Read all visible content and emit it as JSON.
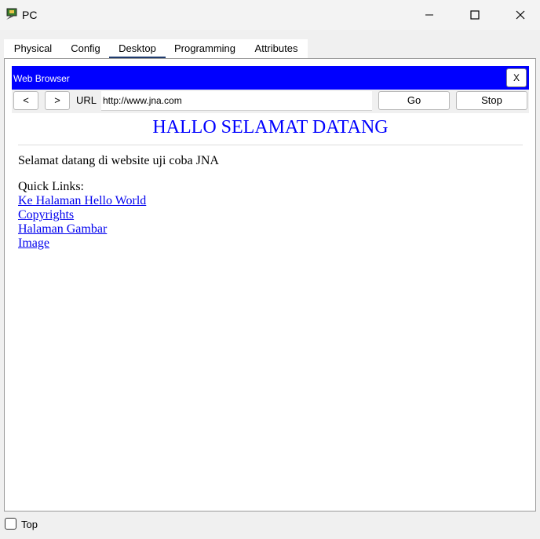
{
  "window": {
    "title": "PC"
  },
  "tabs": [
    {
      "label": "Physical"
    },
    {
      "label": "Config"
    },
    {
      "label": "Desktop"
    },
    {
      "label": "Programming"
    },
    {
      "label": "Attributes"
    }
  ],
  "active_tab": "Desktop",
  "browser": {
    "title": "Web Browser",
    "close_label": "X",
    "back_label": "<",
    "forward_label": ">",
    "url_label": "URL",
    "url_value": "http://www.jna.com",
    "go_label": "Go",
    "stop_label": "Stop"
  },
  "page": {
    "heading": "HALLO SELAMAT DATANG",
    "intro": "Selamat datang di website uji coba JNA",
    "quick_links_label": "Quick Links:",
    "links": [
      {
        "label": "Ke Halaman Hello World"
      },
      {
        "label": "Copyrights"
      },
      {
        "label": "Halaman Gambar"
      },
      {
        "label": "Image"
      }
    ]
  },
  "footer": {
    "top_label": "Top",
    "top_checked": false
  },
  "colors": {
    "header_bg": "#0000ff",
    "heading": "#0000ff",
    "link": "#0000ee"
  }
}
